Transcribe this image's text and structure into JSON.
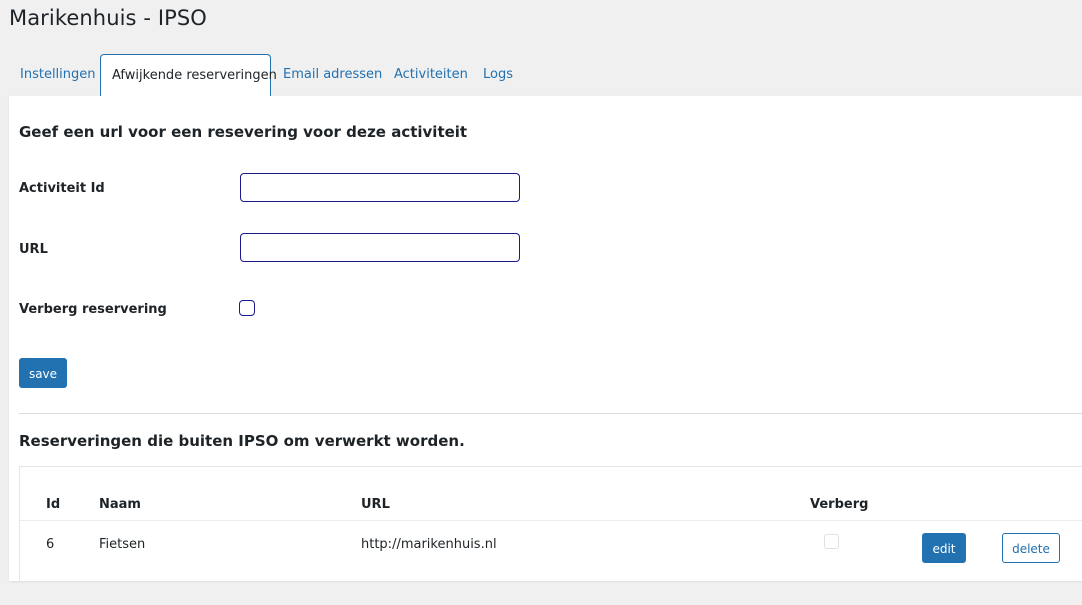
{
  "page": {
    "title": "Marikenhuis - IPSO"
  },
  "tabs": [
    {
      "label": "Instellingen",
      "active": false
    },
    {
      "label": "Afwijkende reserveringen",
      "active": true
    },
    {
      "label": "Email adressen",
      "active": false
    },
    {
      "label": "Activiteiten",
      "active": false
    },
    {
      "label": "Logs",
      "active": false
    }
  ],
  "form": {
    "heading": "Geef een url voor een resevering voor deze activiteit",
    "activity_id": {
      "label": "Activiteit Id",
      "value": ""
    },
    "url": {
      "label": "URL",
      "value": ""
    },
    "hide": {
      "label": "Verberg reservering",
      "checked": false
    },
    "save_label": "save"
  },
  "list": {
    "heading": "Reserveringen die buiten IPSO om verwerkt worden.",
    "columns": [
      "Id",
      "Naam",
      "URL",
      "Verberg"
    ],
    "rows": [
      {
        "id": "6",
        "naam": "Fietsen",
        "url": "http://marikenhuis.nl",
        "verberg": false,
        "edit_label": "edit",
        "delete_label": "delete"
      }
    ]
  },
  "colors": {
    "accent": "#2271b1",
    "background": "#f0f0f1",
    "input_border": "#1a1a8c"
  }
}
